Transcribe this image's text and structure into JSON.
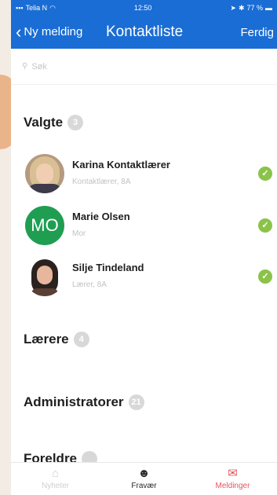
{
  "statusbar": {
    "carrier": "Telia N",
    "time": "12:50",
    "battery": "77 %"
  },
  "navbar": {
    "back_label": "Ny melding",
    "title": "Kontaktliste",
    "done_label": "Ferdig"
  },
  "search": {
    "placeholder": "Søk"
  },
  "sections": {
    "valgte": {
      "label": "Valgte",
      "count": "3"
    },
    "laerere": {
      "label": "Lærere",
      "count": "4"
    },
    "administratorer": {
      "label": "Administratorer",
      "count": "21"
    },
    "foreldre": {
      "label": "Foreldre",
      "count": ""
    }
  },
  "selected_contacts": [
    {
      "name": "Karina Kontaktlærer",
      "role": "Kontaktlærer, 8A",
      "selected": true
    },
    {
      "name": "Marie Olsen",
      "role": "Mor",
      "initials": "MO",
      "avatar_color": "#1f9e52",
      "selected": true
    },
    {
      "name": "Silje Tindeland",
      "role": "Lærer, 8A",
      "selected": true
    }
  ],
  "tabbar": {
    "tabs": [
      {
        "label": "Nyheter",
        "icon": "home-icon",
        "state": "disabled"
      },
      {
        "label": "Fravær",
        "icon": "person-absence-icon",
        "state": "normal"
      },
      {
        "label": "Meldinger",
        "icon": "mail-icon",
        "state": "active"
      }
    ]
  },
  "colors": {
    "header_blue": "#1a6dd4",
    "check_green": "#8bc34a",
    "active_tab_red": "#e8545b"
  }
}
